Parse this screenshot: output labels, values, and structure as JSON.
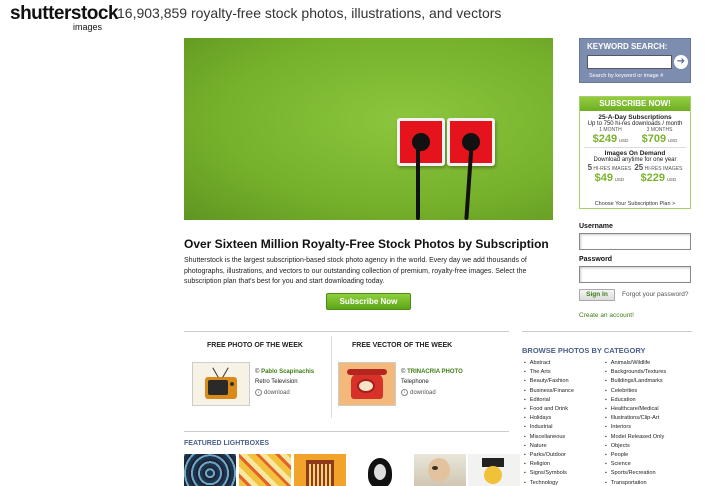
{
  "header": {
    "logo_text": "shutterstock",
    "logo_sub": "images",
    "tagline": "16,903,859 royalty-free stock photos, illustrations, and vectors"
  },
  "main": {
    "headline": "Over Sixteen Million Royalty-Free Stock Photos by Subscription",
    "body": "Shutterstock is the largest subscription-based stock photo agency in the world. Every day we add thousands of photographs, illustrations, and vectors to our outstanding collection of premium, royalty-free images. Select the subscription plan that's best for you and start downloading today.",
    "subscribe_button": "Subscribe Now"
  },
  "free_photo": {
    "title": "FREE PHOTO OF THE WEEK",
    "copyright": "© ",
    "author": "Pablo Scapinachis",
    "caption": "Retro Television",
    "download": "download"
  },
  "free_vector": {
    "title": "FREE VECTOR OF THE WEEK",
    "copyright": "© ",
    "author": "TRINACRIA PHOTO",
    "caption": "Telephone",
    "download": "download"
  },
  "lightboxes": {
    "title": "FEATURED LIGHTBOXES"
  },
  "keyword_search": {
    "title": "KEYWORD SEARCH:",
    "hint": "Search by keyword or image #",
    "go_symbol": "➔",
    "value": ""
  },
  "subscribe_box": {
    "title": "SUBSCRIBE NOW!",
    "plan1_title": "25-A-Day Subscriptions",
    "plan1_sub": "Up to 750 hi-res downloads / month",
    "plan1_opt1_label": "1 MONTH",
    "plan1_opt1_price": "$249",
    "plan1_opt2_label": "3 MONTHS",
    "plan1_opt2_price": "$709",
    "usd": "USD",
    "plan2_title": "Images On Demand",
    "plan2_sub": "Download anytime for one year",
    "plan2_opt1_num": "5",
    "plan2_opt1_label": "HI-RES IMAGES",
    "plan2_opt1_price": "$49",
    "plan2_opt2_num": "25",
    "plan2_opt2_label": "HI-RES IMAGES",
    "plan2_opt2_price": "$229",
    "footer": "Choose Your Subscription Plan >"
  },
  "login": {
    "username_label": "Username",
    "password_label": "Password",
    "signin_button": "Sign In",
    "forgot_link": "Forgot your password?",
    "create_link": "Create an account!"
  },
  "browse": {
    "title": "BROWSE PHOTOS BY CATEGORY",
    "col1": [
      "Abstract",
      "The Arts",
      "Beauty/Fashion",
      "Business/Finance",
      "Editorial",
      "Food and Drink",
      "Holidays",
      "Industrial",
      "Miscellaneous",
      "Nature",
      "Parks/Outdoor",
      "Religion",
      "Signs/Symbols",
      "Technology"
    ],
    "col2": [
      "Animals/Wildlife",
      "Backgrounds/Textures",
      "Buildings/Landmarks",
      "Celebrities",
      "Education",
      "Healthcare/Medical",
      "Illustrations/Clip-Art",
      "Interiors",
      "Model Released Only",
      "Objects",
      "People",
      "Science",
      "Sports/Recreation",
      "Transportation"
    ]
  },
  "colors": {
    "brand_green": "#7bb32e",
    "header_blue": "#4a5f8a",
    "outlet_red": "#e5141c",
    "hero_green": "#76b12b"
  }
}
